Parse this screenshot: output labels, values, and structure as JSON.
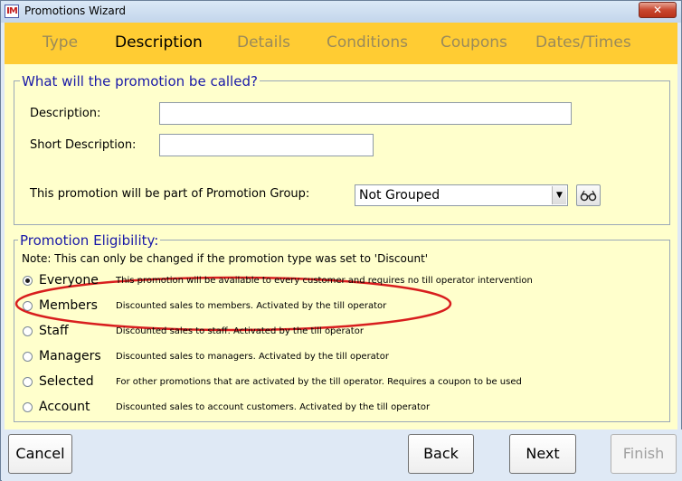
{
  "window": {
    "icon_text": "IM",
    "title": "Promotions Wizard",
    "close_glyph": "✕"
  },
  "tabs": [
    {
      "label": "Type",
      "active": false
    },
    {
      "label": "Description",
      "active": true
    },
    {
      "label": "Details",
      "active": false
    },
    {
      "label": "Conditions",
      "active": false
    },
    {
      "label": "Coupons",
      "active": false
    },
    {
      "label": "Dates/Times",
      "active": false
    }
  ],
  "naming": {
    "legend": "What will the promotion be called?",
    "description_label": "Description:",
    "description_value": "",
    "short_description_label": "Short Description:",
    "short_description_value": "",
    "group_label": "This promotion will be part of Promotion Group:",
    "group_value": "Not Grouped",
    "group_lookup_icon": "glasses-icon"
  },
  "eligibility": {
    "legend": "Promotion Eligibility:",
    "note": "Note: This can only be changed if the promotion type was set to 'Discount'",
    "options": [
      {
        "label": "Everyone",
        "desc": "This promotion will be available to every customer and requires no till operator intervention",
        "checked": true
      },
      {
        "label": "Members",
        "desc": "Discounted sales to members. Activated by the till operator",
        "checked": false
      },
      {
        "label": "Staff",
        "desc": "Discounted sales to staff. Activated by the till operator",
        "checked": false
      },
      {
        "label": "Managers",
        "desc": "Discounted sales to managers. Activated by the till operator",
        "checked": false
      },
      {
        "label": "Selected",
        "desc": "For other promotions that are activated by the till operator. Requires a coupon to be used",
        "checked": false
      },
      {
        "label": "Account",
        "desc": "Discounted sales to account customers.  Activated by the till operator",
        "checked": false
      }
    ],
    "annotation_color": "#d81e1e"
  },
  "buttons": {
    "cancel": "Cancel",
    "back": "Back",
    "next": "Next",
    "finish": "Finish"
  },
  "colors": {
    "tabbar": "#ffcc33",
    "content": "#ffffcc",
    "legend_text": "#1a1aa8"
  }
}
